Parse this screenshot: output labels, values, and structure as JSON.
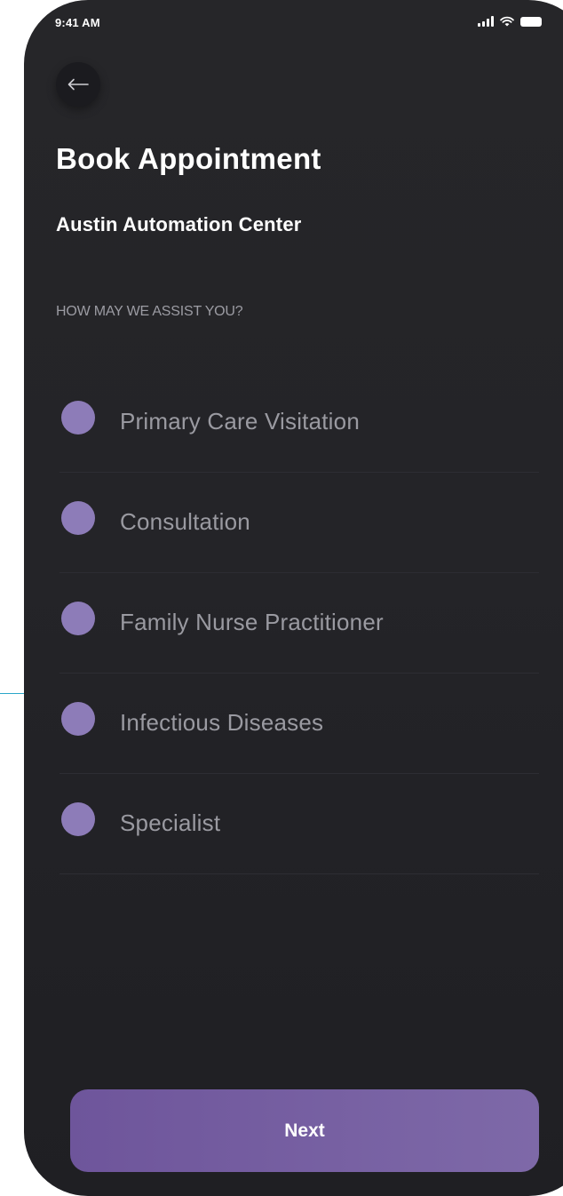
{
  "status_bar": {
    "time": "9:41 AM",
    "icons": [
      "signal-icon",
      "wifi-icon",
      "battery-icon"
    ]
  },
  "header": {
    "back_icon": "back-arrow-icon",
    "title": "Book Appointment"
  },
  "center": {
    "name": "Austin Automation Center"
  },
  "question": "HOW MAY WE ASSIST YOU?",
  "options": [
    {
      "label": "Primary Care Visitation"
    },
    {
      "label": "Consultation"
    },
    {
      "label": "Family Nurse Practitioner"
    },
    {
      "label": "Infectious Diseases"
    },
    {
      "label": "Specialist"
    }
  ],
  "next_button": {
    "label": "Next"
  },
  "colors": {
    "background": "#242428",
    "accent": "#8d7cb8",
    "button": "#7462a2",
    "annotation": "#2aa7c9"
  }
}
